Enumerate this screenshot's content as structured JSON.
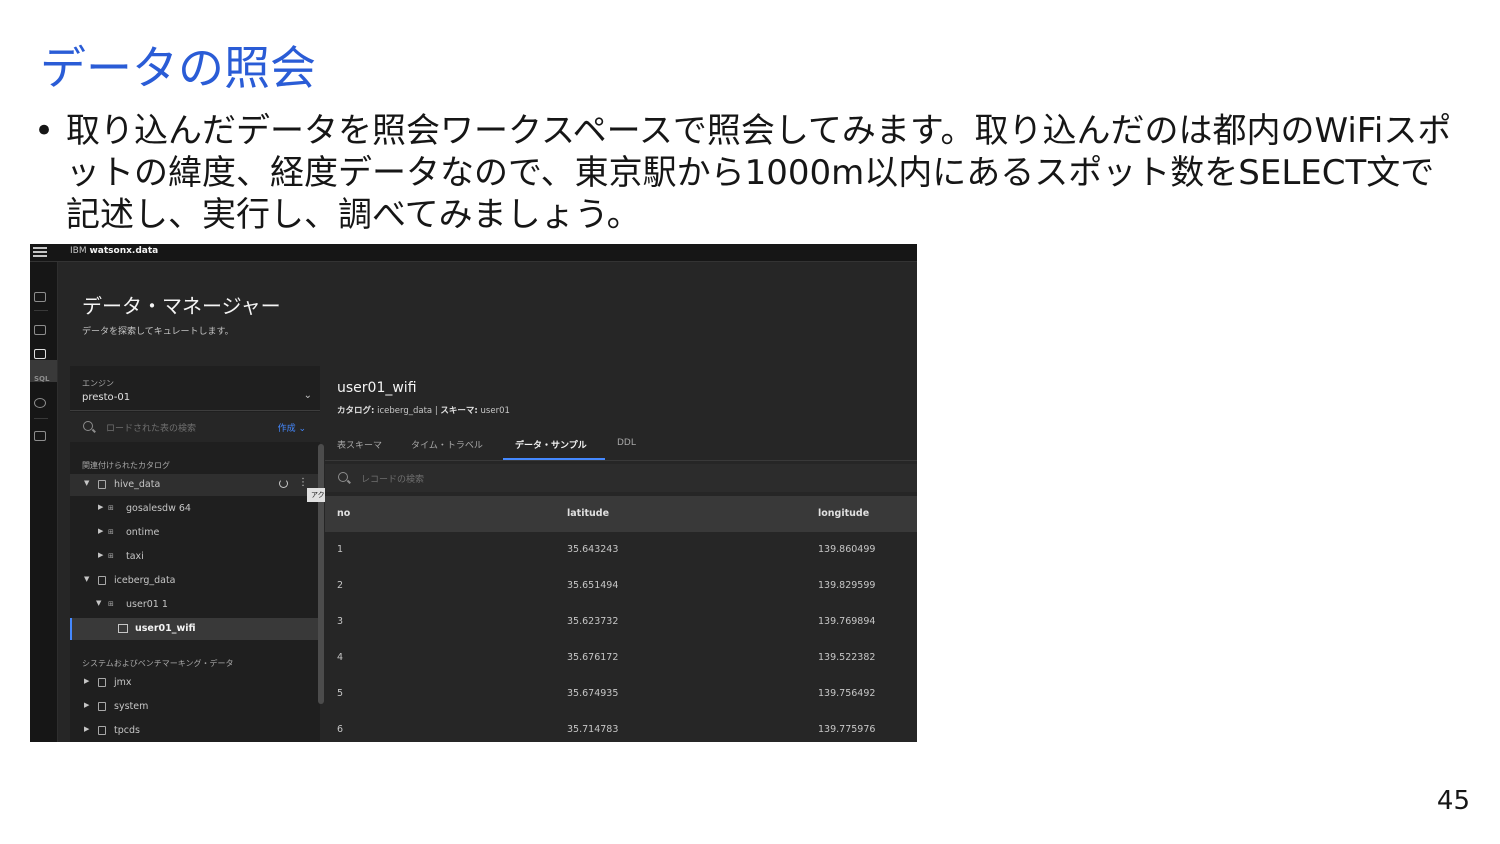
{
  "slide": {
    "title": "データの照会",
    "bullet": "取り込んだデータを照会ワークスペースで照会してみます。取り込んだのは都内のWiFiスポットの緯度、経度データなので、東京駅から1000m以内にあるスポット数をSELECT文で記述し、実行し、調べてみましょう。",
    "bullet_marker": "•",
    "page_number": "45"
  },
  "app": {
    "brand_prefix": "IBM",
    "brand_name": "watsonx.data",
    "page_title": "データ・マネージャー",
    "page_subtitle": "データを探索してキュレートします。",
    "rail_icons": [
      "home-icon",
      "infrastructure-icon",
      "data-manager-icon",
      "sql-icon",
      "history-icon",
      "access-icon"
    ],
    "rail_sql_text": "SQL"
  },
  "left_panel": {
    "engine_label": "エンジン",
    "engine_value": "presto-01",
    "search_placeholder": "ロードされた表の検索",
    "create_label": "作成",
    "related_catalogs_label": "関連付けられたカタログ",
    "system_catalogs_label": "システムおよびベンチマーキング・データ",
    "tooltip": "アクション",
    "tree": [
      {
        "label": "hive_data",
        "level": 0,
        "type": "catalog",
        "expanded": true
      },
      {
        "label": "gosalesdw  64",
        "level": 1,
        "type": "schema",
        "expanded": false
      },
      {
        "label": "ontime",
        "level": 1,
        "type": "schema",
        "expanded": false
      },
      {
        "label": "taxi",
        "level": 1,
        "type": "schema",
        "expanded": false
      },
      {
        "label": "iceberg_data",
        "level": 0,
        "type": "catalog",
        "expanded": true
      },
      {
        "label": "user01  1",
        "level": 1,
        "type": "schema",
        "expanded": true
      },
      {
        "label": "user01_wifi",
        "level": 2,
        "type": "table",
        "selected": true
      }
    ],
    "system_tree": [
      {
        "label": "jmx"
      },
      {
        "label": "system"
      },
      {
        "label": "tpcds"
      }
    ]
  },
  "right_panel": {
    "table_name": "user01_wifi",
    "catalog_label": "カタログ:",
    "catalog_value": "iceberg_data",
    "schema_label": "スキーマ:",
    "schema_value": "user01",
    "tabs": [
      "表スキーマ",
      "タイム・トラベル",
      "データ・サンプル",
      "DDL"
    ],
    "active_tab": 2,
    "record_search_placeholder": "レコードの検索",
    "columns": [
      "no",
      "latitude",
      "longitude"
    ],
    "rows": [
      [
        "1",
        "35.643243",
        "139.860499"
      ],
      [
        "2",
        "35.651494",
        "139.829599"
      ],
      [
        "3",
        "35.623732",
        "139.769894"
      ],
      [
        "4",
        "35.676172",
        "139.522382"
      ],
      [
        "5",
        "35.674935",
        "139.756492"
      ],
      [
        "6",
        "35.714783",
        "139.775976"
      ]
    ]
  },
  "colors": {
    "title_blue": "#2a5cd6",
    "accent_blue": "#4589ff",
    "app_bg": "#262626"
  }
}
